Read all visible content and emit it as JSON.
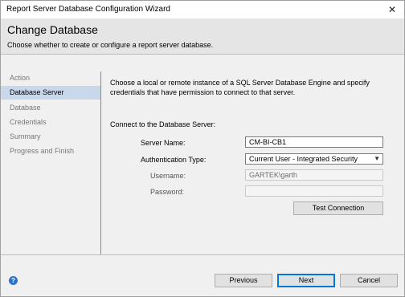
{
  "window": {
    "title": "Report Server Database Configuration Wizard",
    "close_glyph": "✕"
  },
  "header": {
    "title": "Change Database",
    "subtitle": "Choose whether to create or configure a report server database."
  },
  "sidebar": {
    "items": [
      {
        "label": "Action",
        "active": false
      },
      {
        "label": "Database Server",
        "active": true
      },
      {
        "label": "Database",
        "active": false
      },
      {
        "label": "Credentials",
        "active": false
      },
      {
        "label": "Summary",
        "active": false
      },
      {
        "label": "Progress and Finish",
        "active": false
      }
    ]
  },
  "main": {
    "description": "Choose a local or remote instance of a SQL Server Database Engine and specify credentials that have permission to connect to that server.",
    "section_label": "Connect to the Database Server:",
    "server_name_label": "Server Name:",
    "server_name_value": "CM-BI-CB1",
    "auth_label": "Authentication Type:",
    "auth_value": "Current User - Integrated Security",
    "username_label": "Username:",
    "username_value": "GARTEK\\garth",
    "password_label": "Password:",
    "password_value": "",
    "test_connection_label": "Test Connection"
  },
  "footer": {
    "previous_label": "Previous",
    "next_label": "Next",
    "cancel_label": "Cancel",
    "help_glyph": "?"
  },
  "colors": {
    "accent": "#0078d7",
    "selected_bg": "#c9d7ea",
    "header_bg": "#e5e5e5"
  }
}
